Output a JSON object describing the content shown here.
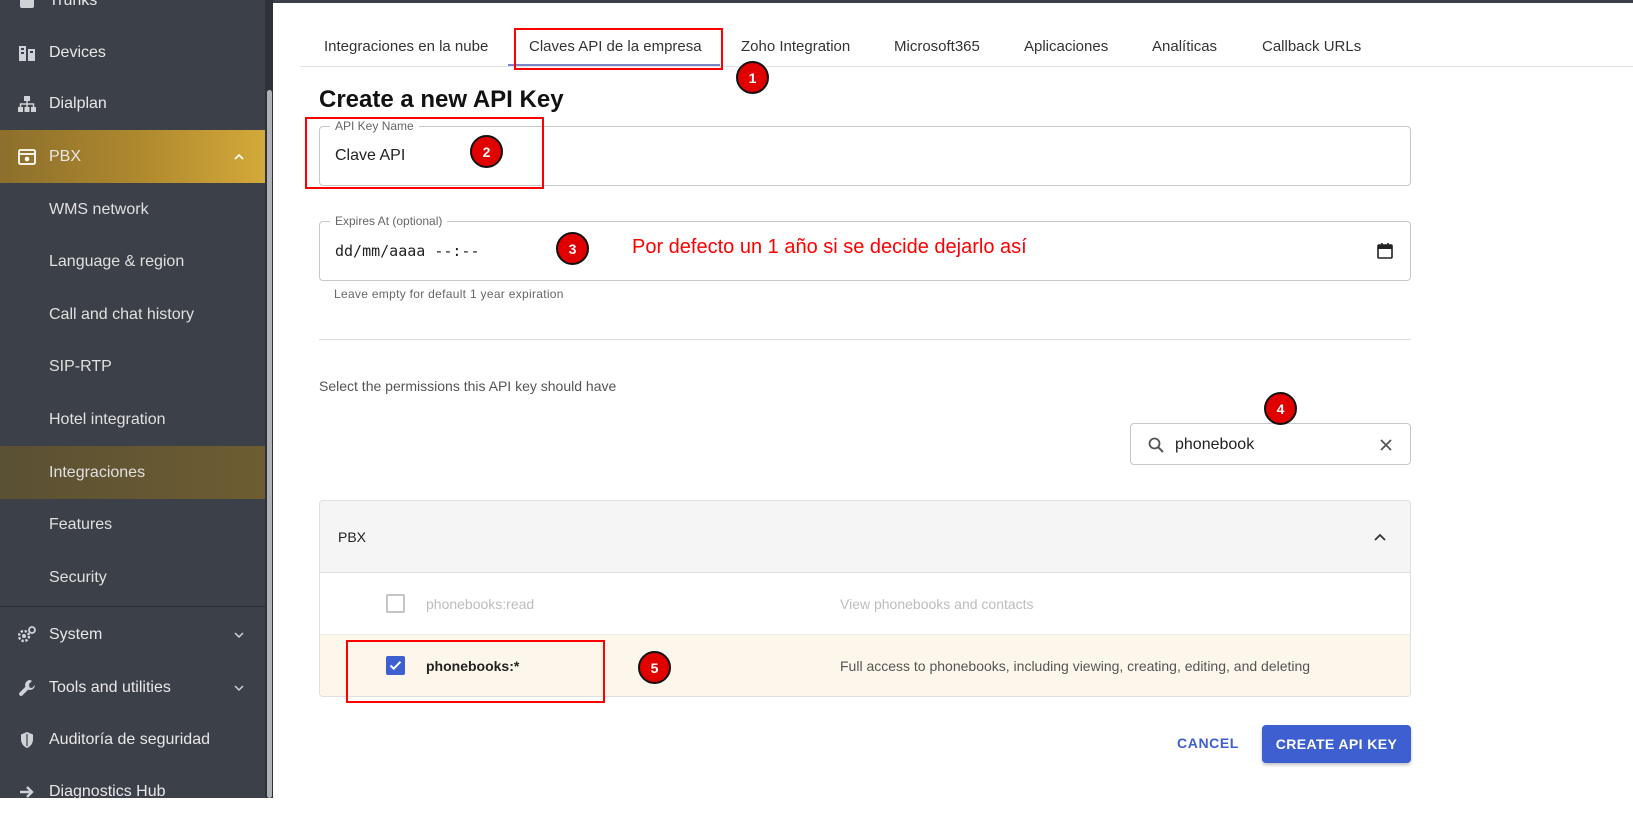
{
  "sidebar": {
    "items": [
      {
        "label": "Trunks"
      },
      {
        "label": "Devices"
      },
      {
        "label": "Dialplan"
      },
      {
        "label": "PBX"
      },
      {
        "label": "WMS network"
      },
      {
        "label": "Language & region"
      },
      {
        "label": "Call and chat history"
      },
      {
        "label": "SIP-RTP"
      },
      {
        "label": "Hotel integration"
      },
      {
        "label": "Integraciones"
      },
      {
        "label": "Features"
      },
      {
        "label": "Security"
      },
      {
        "label": "System"
      },
      {
        "label": "Tools and utilities"
      },
      {
        "label": "Auditoría de seguridad"
      },
      {
        "label": "Diagnostics Hub"
      }
    ]
  },
  "tabs": [
    {
      "label": "Integraciones en la nube"
    },
    {
      "label": "Claves API de la empresa"
    },
    {
      "label": "Zoho Integration"
    },
    {
      "label": "Microsoft365"
    },
    {
      "label": "Aplicaciones"
    },
    {
      "label": "Analíticas"
    },
    {
      "label": "Callback URLs"
    }
  ],
  "form": {
    "title": "Create a new API Key",
    "name_legend": "API Key Name",
    "name_value": "Clave API",
    "expires_legend": "Expires At (optional)",
    "expires_placeholder": "dd/mm/aaaa --:--",
    "expires_helper": "Leave empty for default 1 year expiration",
    "permissions_label": "Select the permissions this API key should have",
    "search_value": "phonebook"
  },
  "permissions": {
    "group": "PBX",
    "rows": [
      {
        "name": "phonebooks:read",
        "description": "View phonebooks and contacts",
        "checked": false
      },
      {
        "name": "phonebooks:*",
        "description": "Full access to phonebooks, including viewing, creating, editing, and deleting",
        "checked": true
      }
    ]
  },
  "actions": {
    "cancel": "CANCEL",
    "create": "CREATE API KEY"
  },
  "annotations": {
    "badges": [
      "1",
      "2",
      "3",
      "4",
      "5"
    ],
    "note": "Por defecto un 1 año si se decide dejarlo así"
  },
  "colors": {
    "accent": "#3d5fd0",
    "sidebar_bg": "#3c4048",
    "pbx_gold": "#d4a93a",
    "annotation_red": "#ff0000"
  }
}
